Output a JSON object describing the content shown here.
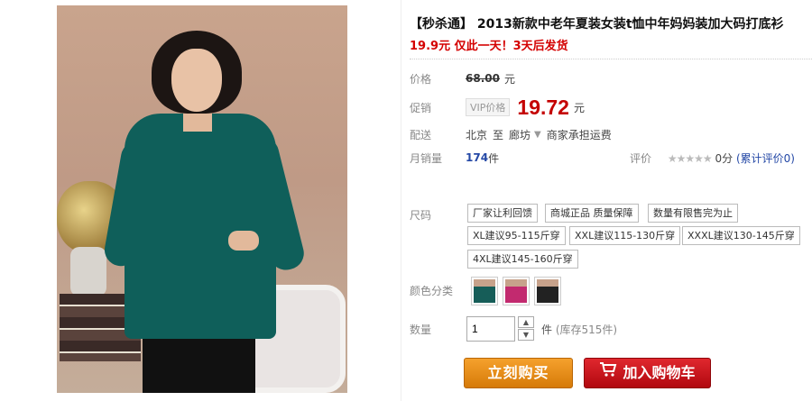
{
  "product": {
    "title": "【秒杀通】 2013新款中老年夏装女装t恤中年妈妈装加大码打底衫",
    "promo": "19.9元 仅此一天！3天后发货"
  },
  "price": {
    "label": "价格",
    "original": "68.00",
    "unit": "元"
  },
  "promo_price": {
    "label": "促销",
    "vip_tag": "VIP价格",
    "value": "19.72",
    "unit": "元"
  },
  "shipping": {
    "label": "配送",
    "from": "北京",
    "to_word": "至",
    "to": "廊坊",
    "note": "商家承担运费"
  },
  "sales": {
    "label": "月销量",
    "count": "174",
    "unit": "件",
    "rating_label": "评价",
    "stars": "★★★★★",
    "score": "0分",
    "review_link": "(累计评价0)"
  },
  "size": {
    "label": "尺码",
    "options": [
      "厂家让利回馈",
      "商城正品 质量保障",
      "数量有限售完为止",
      "XL建议95-115斤穿",
      "XXL建议115-130斤穿",
      "XXXL建议130-145斤穿",
      "4XL建议145-160斤穿"
    ]
  },
  "color": {
    "label": "颜色分类",
    "swatches": [
      "#165d58",
      "#c22a6f",
      "#222222"
    ]
  },
  "quantity": {
    "label": "数量",
    "value": "1",
    "unit": "件",
    "stock": "(库存515件)"
  },
  "actions": {
    "buy_now": "立刻购买",
    "add_to_cart": "加入购物车"
  }
}
